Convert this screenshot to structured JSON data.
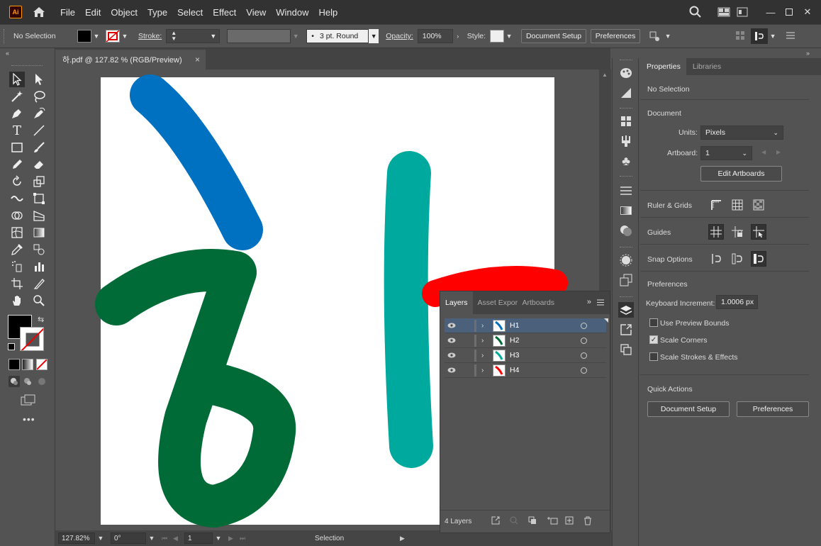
{
  "app": {
    "logo": "Ai",
    "menu": [
      "File",
      "Edit",
      "Object",
      "Type",
      "Select",
      "Effect",
      "View",
      "Window",
      "Help"
    ]
  },
  "control_bar": {
    "selection_status": "No Selection",
    "stroke_label": "Stroke:",
    "brush_value": "3 pt. Round",
    "opacity_label": "Opacity:",
    "opacity_value": "100%",
    "style_label": "Style:",
    "document_setup": "Document Setup",
    "preferences": "Preferences"
  },
  "document_tab": {
    "title": "하.pdf @ 127.82 % (RGB/Preview)",
    "close": "×"
  },
  "status_bar": {
    "zoom": "127.82%",
    "rotation": "0°",
    "artboard_number": "1",
    "tool_status": "Selection"
  },
  "properties_panel": {
    "tabs": [
      "Properties",
      "Libraries"
    ],
    "selection_status": "No Selection",
    "document_section": "Document",
    "units_label": "Units:",
    "units_value": "Pixels",
    "artboard_label": "Artboard:",
    "artboard_value": "1",
    "edit_artboards": "Edit Artboards",
    "ruler_grids": "Ruler & Grids",
    "guides": "Guides",
    "snap_options": "Snap Options",
    "preferences_section": "Preferences",
    "keyboard_increment_label": "Keyboard Increment:",
    "keyboard_increment_value": "1.0006 px",
    "use_preview_bounds": "Use Preview Bounds",
    "scale_corners": "Scale Corners",
    "scale_strokes_effects": "Scale Strokes & Effects",
    "quick_actions": "Quick Actions",
    "document_setup": "Document Setup",
    "preferences": "Preferences",
    "checked": {
      "use_preview_bounds": false,
      "scale_corners": true,
      "scale_strokes_effects": false
    }
  },
  "layers_panel": {
    "tabs": [
      "Layers",
      "Asset Expor",
      "Artboards"
    ],
    "layers": [
      {
        "name": "H1",
        "color": "#0070c0",
        "selected": true
      },
      {
        "name": "H2",
        "color": "#006b36",
        "selected": false
      },
      {
        "name": "H3",
        "color": "#00a99d",
        "selected": false
      },
      {
        "name": "H4",
        "color": "#ff0000",
        "selected": false
      }
    ],
    "count_label": "4 Layers"
  },
  "artwork": {
    "colors": {
      "blue_stroke": "#0070c0",
      "green_glyph": "#006b36",
      "teal_stroke": "#00a99d",
      "red_stroke": "#ff0000"
    }
  }
}
